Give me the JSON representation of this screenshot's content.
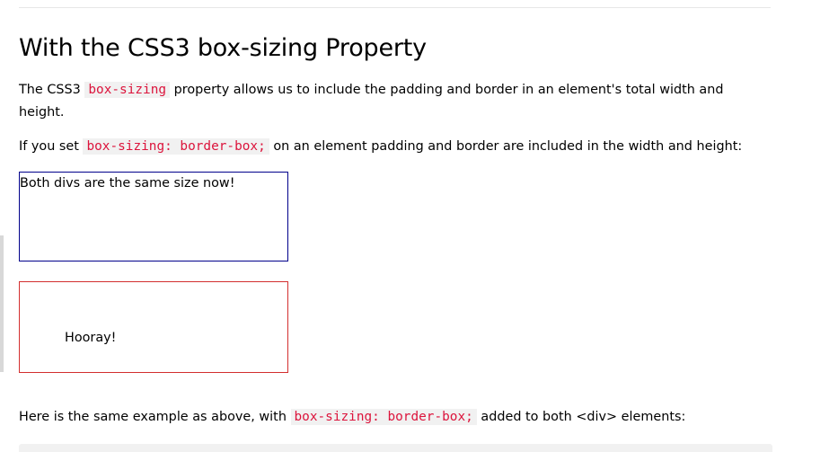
{
  "section": {
    "heading": "With the CSS3 box-sizing Property"
  },
  "paragraph1": {
    "before": "The CSS3 ",
    "code": "box-sizing",
    "after": " property allows us to include the padding and border in an element's total width and height."
  },
  "paragraph2": {
    "before": "If you set ",
    "code": "box-sizing: border-box;",
    "after": " on an element padding and border are included in the width and height:"
  },
  "demo": {
    "box1_text": "Both divs are the same size now!",
    "box2_text": "Hooray!",
    "box1_border_color": "#00008b",
    "box2_border_color": "#d32f2f"
  },
  "paragraph3": {
    "before": "Here is the same example as above, with ",
    "code": "box-sizing: border-box;",
    "after": " added to both <div> elements:"
  },
  "colors": {
    "code_text": "#dc143c",
    "code_background": "#f1f1f1"
  }
}
